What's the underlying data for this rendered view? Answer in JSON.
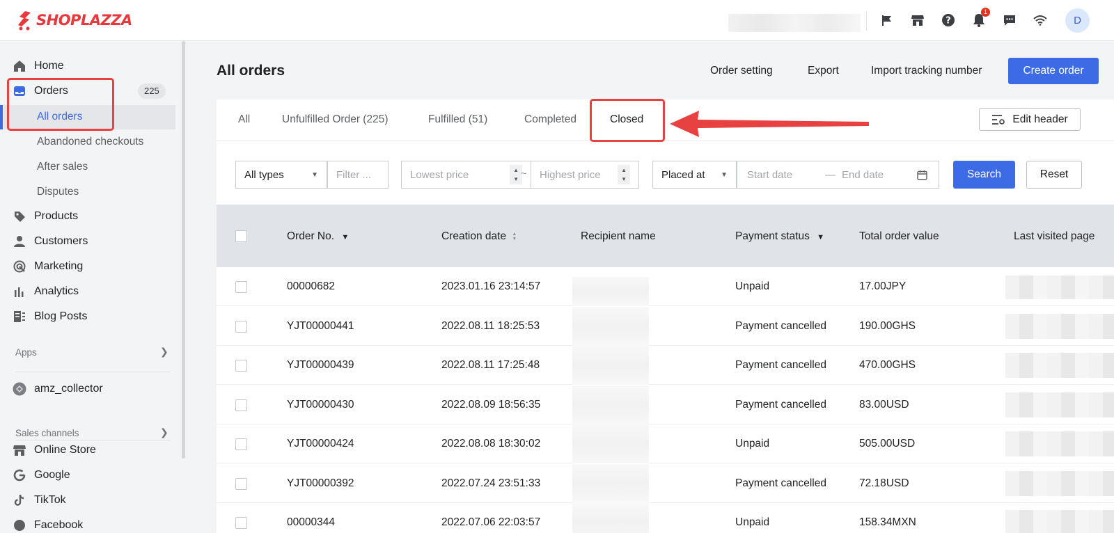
{
  "brand": {
    "name": "SHOPLAZZA",
    "color": "#e8383d"
  },
  "topbar": {
    "icons": [
      "flag-icon",
      "store-icon",
      "help-icon",
      "bell-icon",
      "message-icon",
      "wifi-icon"
    ],
    "notification_count": "1",
    "avatar_initial": "D"
  },
  "sidebar": {
    "items": [
      {
        "label": "Home",
        "icon": "home-icon"
      },
      {
        "label": "Orders",
        "icon": "inbox-icon",
        "count": "225"
      },
      {
        "label": "Products",
        "icon": "tag-icon"
      },
      {
        "label": "Customers",
        "icon": "person-icon"
      },
      {
        "label": "Marketing",
        "icon": "target-icon"
      },
      {
        "label": "Analytics",
        "icon": "bar-chart-icon"
      },
      {
        "label": "Blog Posts",
        "icon": "blog-icon"
      }
    ],
    "order_subitems": [
      "All orders",
      "Abandoned checkouts",
      "After sales",
      "Disputes"
    ],
    "apps_label": "Apps",
    "app_items": [
      {
        "label": "amz_collector"
      }
    ],
    "sales_channels_label": "Sales channels",
    "channels": [
      "Online Store",
      "Google",
      "TikTok",
      "Facebook"
    ]
  },
  "page": {
    "title": "All orders",
    "actions": [
      "Order setting",
      "Export",
      "Import tracking number"
    ],
    "create_label": "Create order"
  },
  "tabs": [
    "All",
    "Unfulfilled Order (225)",
    "Fulfilled (51)",
    "Completed",
    "Closed"
  ],
  "active_tab": "Closed",
  "edit_header_label": "Edit header",
  "filters": {
    "type_value": "All types",
    "filter_placeholder": "Filter ...",
    "lowest_price_placeholder": "Lowest price",
    "range_sep": "~",
    "highest_price_placeholder": "Highest price",
    "date_type_value": "Placed at",
    "start_date_placeholder": "Start date",
    "date_sep": "—",
    "end_date_placeholder": "End date",
    "search_label": "Search",
    "reset_label": "Reset"
  },
  "table": {
    "columns": [
      "Order No.",
      "Creation date",
      "Recipient name",
      "Payment status",
      "Total order value",
      "Last visited page"
    ],
    "rows": [
      {
        "order_no": "00000682",
        "date": "2023.01.16 23:14:57",
        "payment": "Unpaid",
        "total": "17.00JPY"
      },
      {
        "order_no": "YJT00000441",
        "date": "2022.08.11 18:25:53",
        "payment": "Payment cancelled",
        "total": "190.00GHS"
      },
      {
        "order_no": "YJT00000439",
        "date": "2022.08.11 17:25:48",
        "payment": "Payment cancelled",
        "total": "470.00GHS"
      },
      {
        "order_no": "YJT00000430",
        "date": "2022.08.09 18:56:35",
        "payment": "Payment cancelled",
        "total": "83.00USD"
      },
      {
        "order_no": "YJT00000424",
        "date": "2022.08.08 18:30:02",
        "payment": "Unpaid",
        "total": "505.00USD"
      },
      {
        "order_no": "YJT00000392",
        "date": "2022.07.24 23:51:33",
        "payment": "Payment cancelled",
        "total": "72.18USD"
      },
      {
        "order_no": "00000344",
        "date": "2022.07.06 22:03:57",
        "payment": "Unpaid",
        "total": "158.34MXN"
      }
    ]
  },
  "colors": {
    "accent": "#3d6be5",
    "highlight": "#e84141"
  }
}
